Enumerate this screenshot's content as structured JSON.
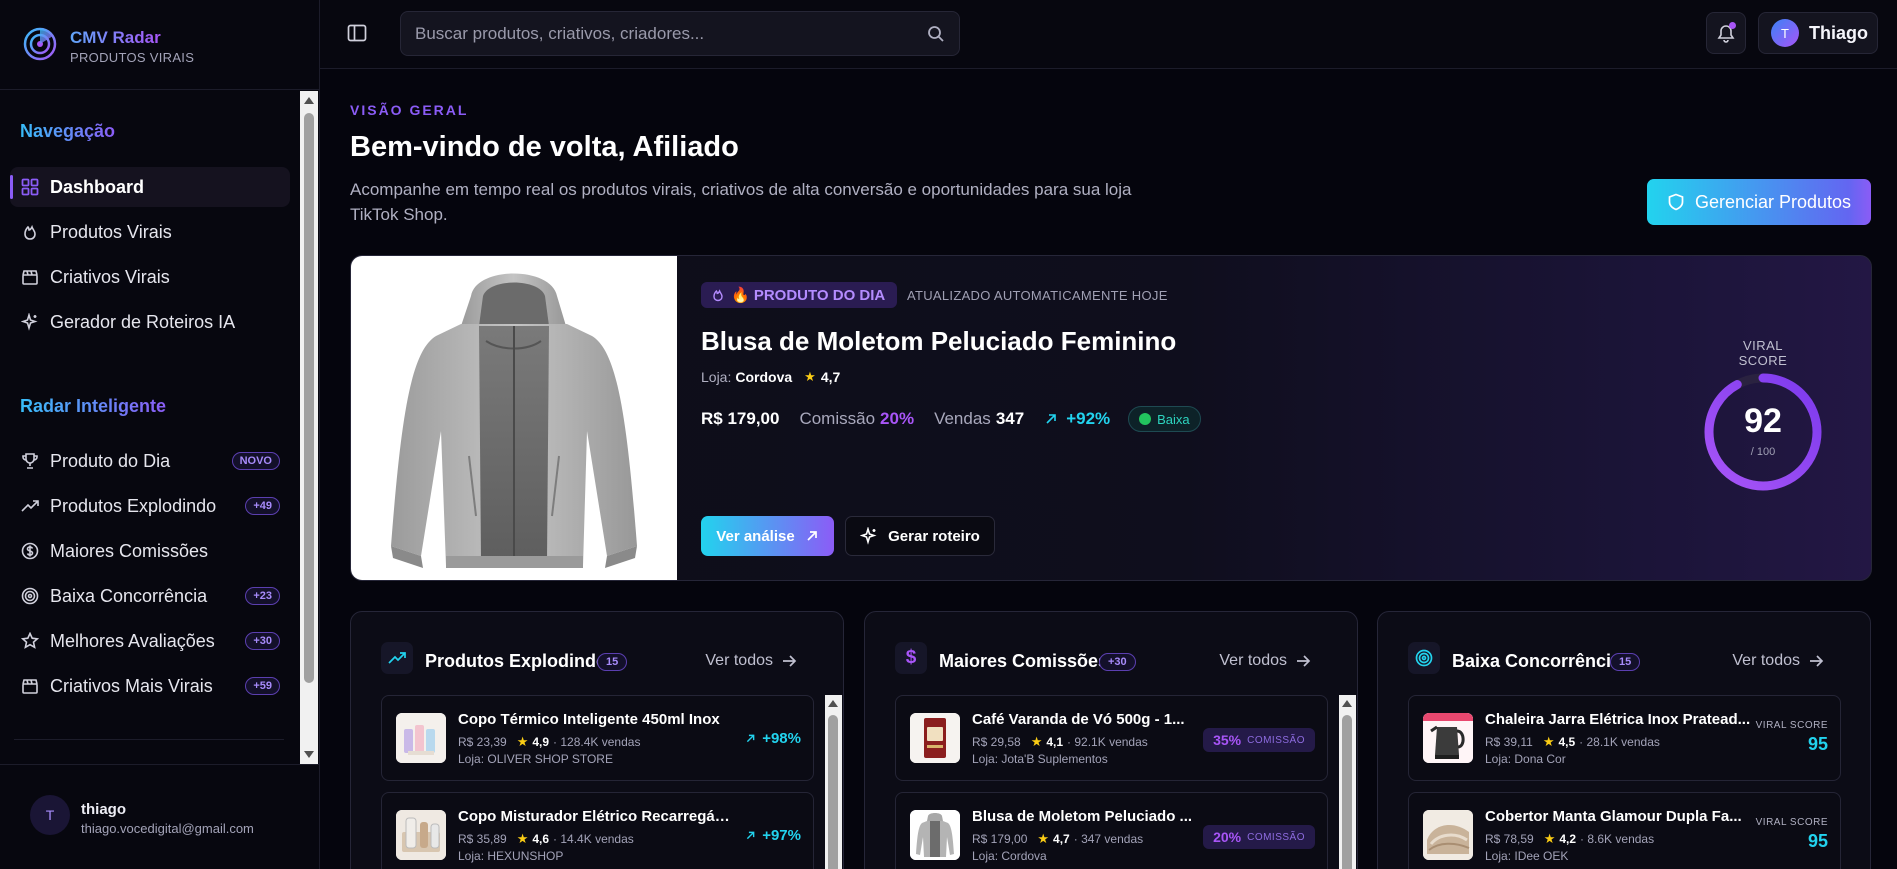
{
  "brand": {
    "title": "CMV Radar",
    "subtitle": "PRODUTOS VIRAIS"
  },
  "sidebar": {
    "section_nav": "Navegação",
    "nav_items": [
      {
        "label": "Dashboard",
        "icon": "grid-icon",
        "active": true
      },
      {
        "label": "Produtos Virais",
        "icon": "flame-icon"
      },
      {
        "label": "Criativos Virais",
        "icon": "clapperboard-icon"
      },
      {
        "label": "Gerador de Roteiros IA",
        "icon": "sparkles-icon"
      }
    ],
    "section_radar": "Radar Inteligente",
    "radar_items": [
      {
        "label": "Produto do Dia",
        "icon": "trophy-icon",
        "badge": "NOVO"
      },
      {
        "label": "Produtos Explodindo",
        "icon": "trending-up-icon",
        "badge": "+49"
      },
      {
        "label": "Maiores Comissões",
        "icon": "dollar-circle-icon"
      },
      {
        "label": "Baixa Concorrência",
        "icon": "target-icon",
        "badge": "+23"
      },
      {
        "label": "Melhores Avaliações",
        "icon": "star-icon",
        "badge": "+30"
      },
      {
        "label": "Criativos Mais Virais",
        "icon": "clapperboard-icon",
        "badge": "+59"
      }
    ],
    "user": {
      "initial": "T",
      "name": "thiago",
      "email": "thiago.vocedigital@gmail.com"
    }
  },
  "topbar": {
    "search_placeholder": "Buscar produtos, criativos, criadores...",
    "profile_initial": "T",
    "profile_name": "Thiago"
  },
  "header": {
    "eyebrow": "VISÃO GERAL",
    "title": "Bem-vindo de volta, Afiliado",
    "subtitle": "Acompanhe em tempo real os produtos virais, criativos de alta conversão e oportunidades para sua loja TikTok Shop.",
    "manage_button": "Gerenciar Produtos"
  },
  "hero": {
    "badge": "🔥 PRODUTO DO DIA",
    "updated": "ATUALIZADO AUTOMATICAMENTE HOJE",
    "product_name": "Blusa de Moletom Peluciado Feminino",
    "store_label": "Loja:",
    "store_name": "Cordova",
    "rating": "4,7",
    "price": "R$ 179,00",
    "commission_label": "Comissão",
    "commission_value": "20%",
    "sales_label": "Vendas",
    "sales_value": "347",
    "growth": "+92%",
    "competition": "Baixa",
    "btn_analysis": "Ver análise",
    "btn_script": "Gerar roteiro",
    "viral_score_label": "VIRAL SCORE",
    "viral_score": "92",
    "viral_score_max": "/ 100",
    "viral_score_fraction": 0.92
  },
  "cards": [
    {
      "title": "Produtos Explodindo",
      "count": "15",
      "view_all": "Ver todos",
      "icon": "trending-up-icon",
      "items": [
        {
          "name": "Copo Térmico Inteligente 450ml Inox",
          "price": "R$ 23,39",
          "rating": "4,9",
          "sales": "· 128.4K vendas",
          "store": "Loja: OLIVER SHOP STORE",
          "growth": "+98%"
        },
        {
          "name": "Copo Misturador Elétrico Recarregáve...",
          "price": "R$ 35,89",
          "rating": "4,6",
          "sales": "· 14.4K vendas",
          "store": "Loja: HEXUNSHOP",
          "growth": "+97%"
        }
      ]
    },
    {
      "title": "Maiores Comissões",
      "count": "+30",
      "view_all": "Ver todos",
      "icon": "dollar-icon",
      "items": [
        {
          "name": "Café Varanda de Vó 500g - 1...",
          "price": "R$ 29,58",
          "rating": "4,1",
          "sales": "· 92.1K vendas",
          "store": "Loja: Jota'B Suplementos",
          "commission": "35%",
          "commission_label": "COMISSÃO"
        },
        {
          "name": "Blusa de Moletom Peluciado ...",
          "price": "R$ 179,00",
          "rating": "4,7",
          "sales": "· 347 vendas",
          "store": "Loja: Cordova",
          "commission": "20%",
          "commission_label": "COMISSÃO"
        }
      ]
    },
    {
      "title": "Baixa Concorrência",
      "count": "15",
      "view_all": "Ver todos",
      "icon": "target-icon",
      "items": [
        {
          "name": "Chaleira Jarra Elétrica Inox Pratead...",
          "price": "R$ 39,11",
          "rating": "4,5",
          "sales": "· 28.1K vendas",
          "store": "Loja: Dona Cor",
          "score_label": "VIRAL SCORE",
          "score": "95"
        },
        {
          "name": "Cobertor Manta Glamour Dupla Fa...",
          "price": "R$ 78,59",
          "rating": "4,2",
          "sales": "· 8.6K vendas",
          "store": "Loja: IDee OEK",
          "score_label": "VIRAL SCORE",
          "score": "95"
        }
      ]
    }
  ],
  "colors": {
    "accent_purple": "#8b5cf6",
    "accent_cyan": "#22d3ee",
    "background": "#05050d"
  }
}
